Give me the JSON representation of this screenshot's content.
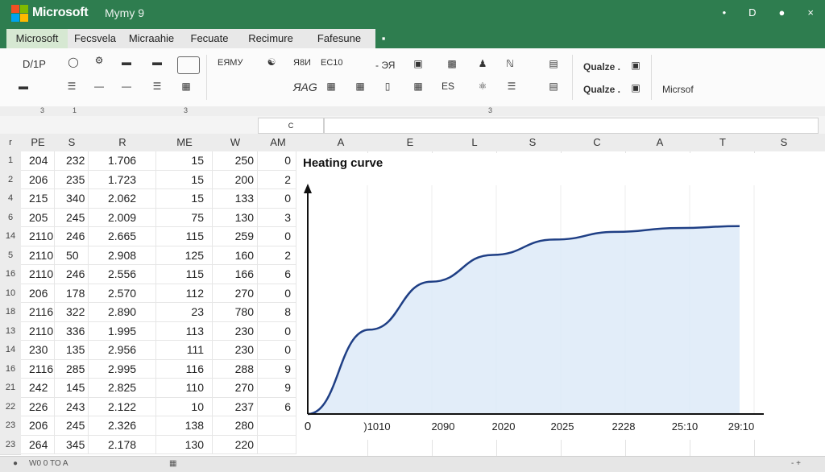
{
  "titlebar": {
    "app_name": "Microsoft",
    "doc_name": "Mymy   9",
    "icons": [
      "minimize-icon",
      "restore-icon",
      "settings-icon",
      "close-icon"
    ]
  },
  "tabs": [
    {
      "label": "Microsoft",
      "active": true
    },
    {
      "label": "Fecsvela",
      "active": false
    },
    {
      "label": "Micraahie",
      "active": false
    },
    {
      "label": "Fecuate",
      "active": false
    },
    {
      "label": "Recimure",
      "active": false
    },
    {
      "label": "Fafesune",
      "active": false
    }
  ],
  "ribbon": {
    "font_size": "D/1P",
    "style_label_1": "Qualze .",
    "style_label_2": "Qualze .",
    "group_label": "Micrsof",
    "text_labels": [
      "ЕЯМУ",
      "Я8И",
      "ЕС10",
      "- ЭЯ",
      "ЯАG",
      "ES"
    ]
  },
  "formula_bar": {
    "name_box": "C",
    "value": ""
  },
  "ruler_marks": [
    "3",
    "1",
    "3",
    "3"
  ],
  "columns": [
    "r",
    "PE",
    "S",
    "R",
    "ME",
    "W",
    "AM",
    "A",
    "E",
    "L",
    "S",
    "C",
    "A",
    "T",
    "S"
  ],
  "table": {
    "row_numbers": [
      "1",
      "2",
      "4",
      "6",
      "14",
      "5",
      "16",
      "10",
      "18",
      "13",
      "14",
      "16",
      "21",
      "22",
      "23",
      "23"
    ],
    "rows": [
      [
        "204",
        "232",
        "1.706",
        "15",
        "250",
        "0"
      ],
      [
        "206",
        "235",
        "1.723",
        "15",
        "200",
        "2"
      ],
      [
        "215",
        "340",
        "2.062",
        "15",
        "133",
        "0"
      ],
      [
        "205",
        "245",
        "2.009",
        "75",
        "130",
        "3"
      ],
      [
        "2110",
        "246",
        "2.665",
        "115",
        "259",
        "0"
      ],
      [
        "2110",
        "50",
        "2.908",
        "125",
        "160",
        "2"
      ],
      [
        "2110",
        "246",
        "2.556",
        "115",
        "166",
        "6"
      ],
      [
        "206",
        "178",
        "2.570",
        "112",
        "270",
        "0"
      ],
      [
        "2116",
        "322",
        "2.890",
        "23",
        "780",
        "8"
      ],
      [
        "2110",
        "336",
        "1.995",
        "113",
        "230",
        "0"
      ],
      [
        "230",
        "135",
        "2.956",
        "111",
        "230",
        "0"
      ],
      [
        "2116",
        "285",
        "2.995",
        "116",
        "288",
        "9"
      ],
      [
        "242",
        "145",
        "2.825",
        "110",
        "270",
        "9"
      ],
      [
        "226",
        "243",
        "2.122",
        "10",
        "237",
        "6"
      ],
      [
        "206",
        "245",
        "2.326",
        "138",
        "280",
        ""
      ],
      [
        "264",
        "345",
        "2.178",
        "130",
        "220",
        ""
      ]
    ]
  },
  "chart_data": {
    "type": "area",
    "title": "Heating curve",
    "xlabel": "",
    "ylabel": "",
    "tick_labels": [
      "0",
      ")1010",
      "2090",
      "2020",
      "2025",
      "2228",
      "25:10",
      "29:10"
    ],
    "curve": "rising-saturating",
    "x": [
      0,
      1,
      2,
      3,
      4,
      5,
      6,
      7
    ],
    "values": [
      0,
      0.44,
      0.69,
      0.83,
      0.91,
      0.95,
      0.97,
      0.98
    ],
    "line_color": "#1f3f85",
    "fill_color": "#dbe9f7"
  },
  "statusbar": {
    "text": "W0  0  TO  A",
    "zoom": "-  +"
  }
}
